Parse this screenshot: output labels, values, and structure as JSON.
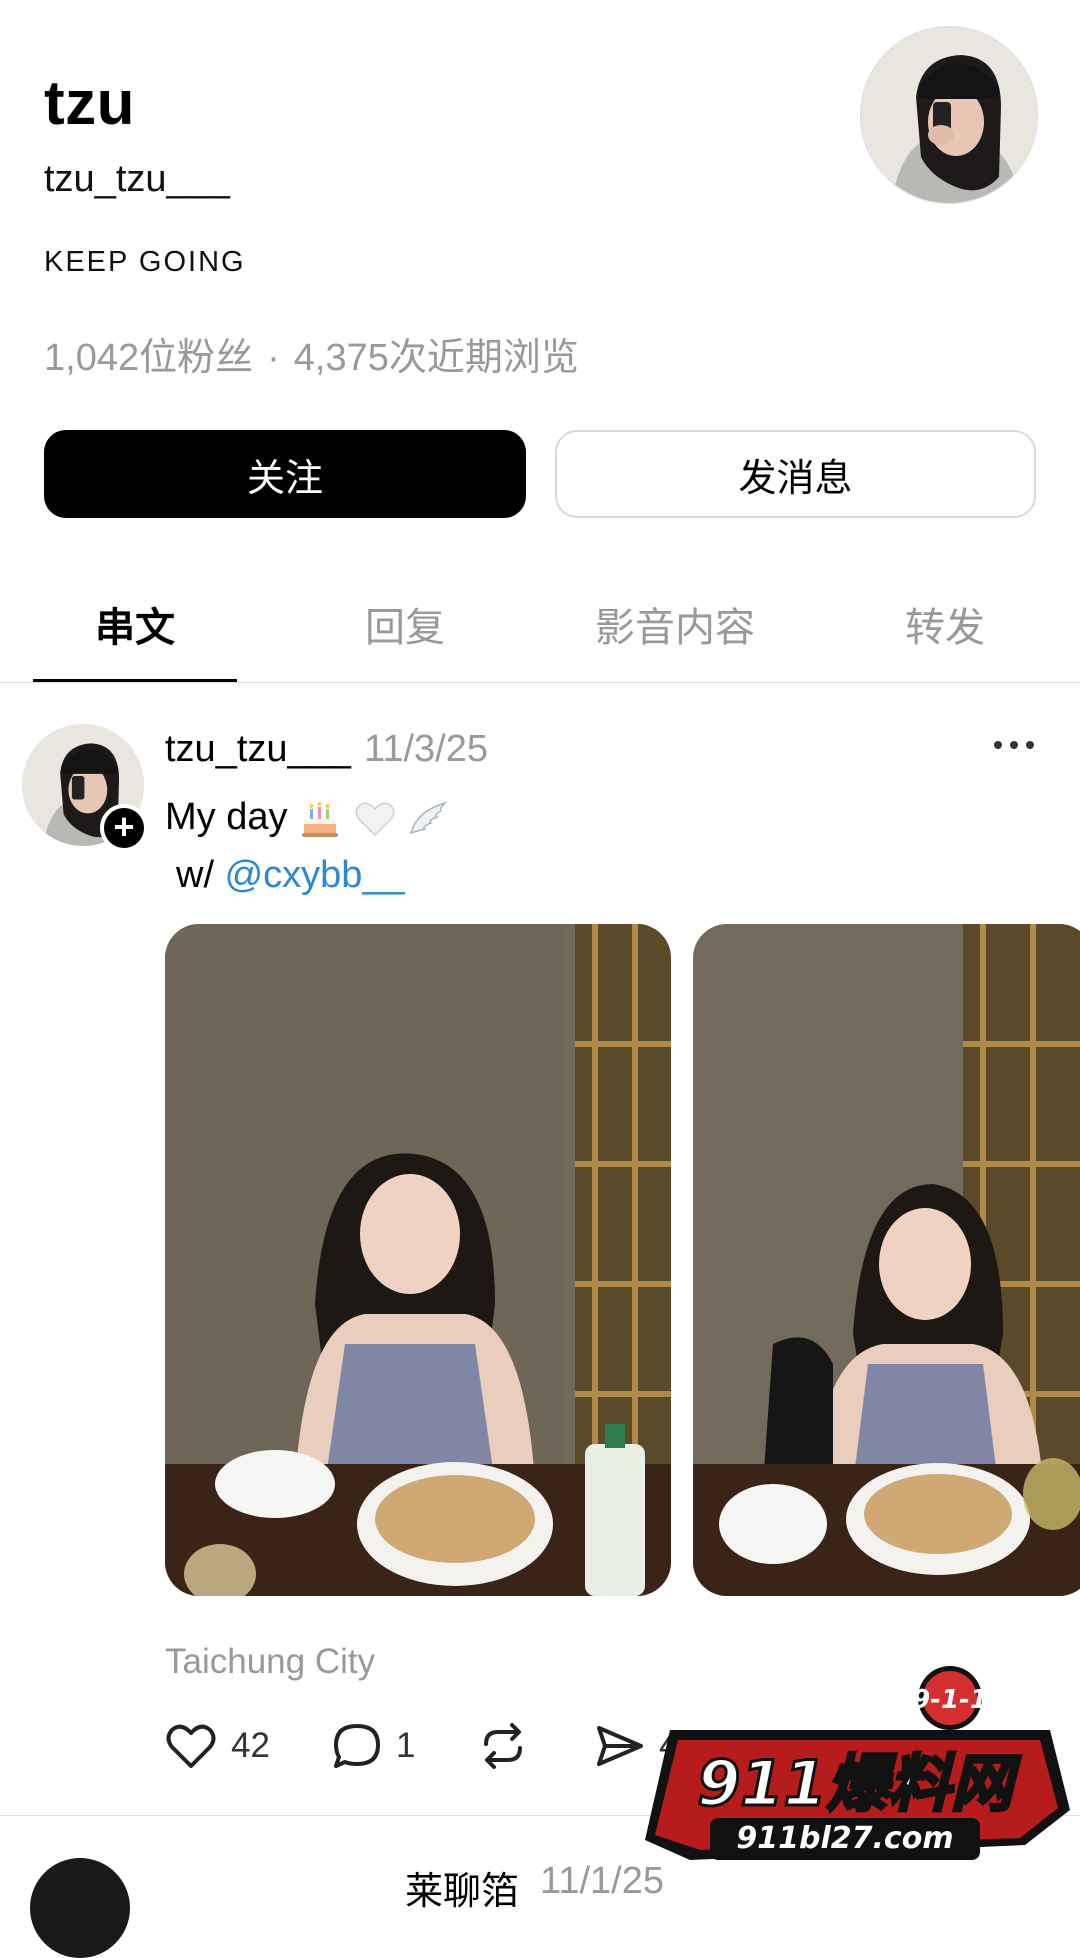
{
  "profile": {
    "display_name": "tzu",
    "username": "tzu_tzu___",
    "bio": "KEEP GOING",
    "followers": "1,042位粉丝",
    "separator": "·",
    "views": "4,375次近期浏览"
  },
  "buttons": {
    "follow": "关注",
    "message": "发消息"
  },
  "tabs": [
    "串文",
    "回复",
    "影音内容",
    "转发"
  ],
  "active_tab": 0,
  "post": {
    "username": "tzu_tzu___",
    "date": "11/3/25",
    "text_line1": "My day",
    "text_prefix_line2": "w/",
    "mention": "@cxybb__",
    "location": "Taichung City",
    "likes": "42",
    "comments": "1",
    "shares": "4"
  },
  "next_post": {
    "username": "莱聊箔",
    "date": "11/1/25"
  },
  "watermark": {
    "top": "9-1-1",
    "main": "911爆料网",
    "url": "911bl27.com"
  },
  "colors": {
    "accent_link": "#2b8ad3",
    "muted": "#999999",
    "primary_button": "#000000"
  }
}
